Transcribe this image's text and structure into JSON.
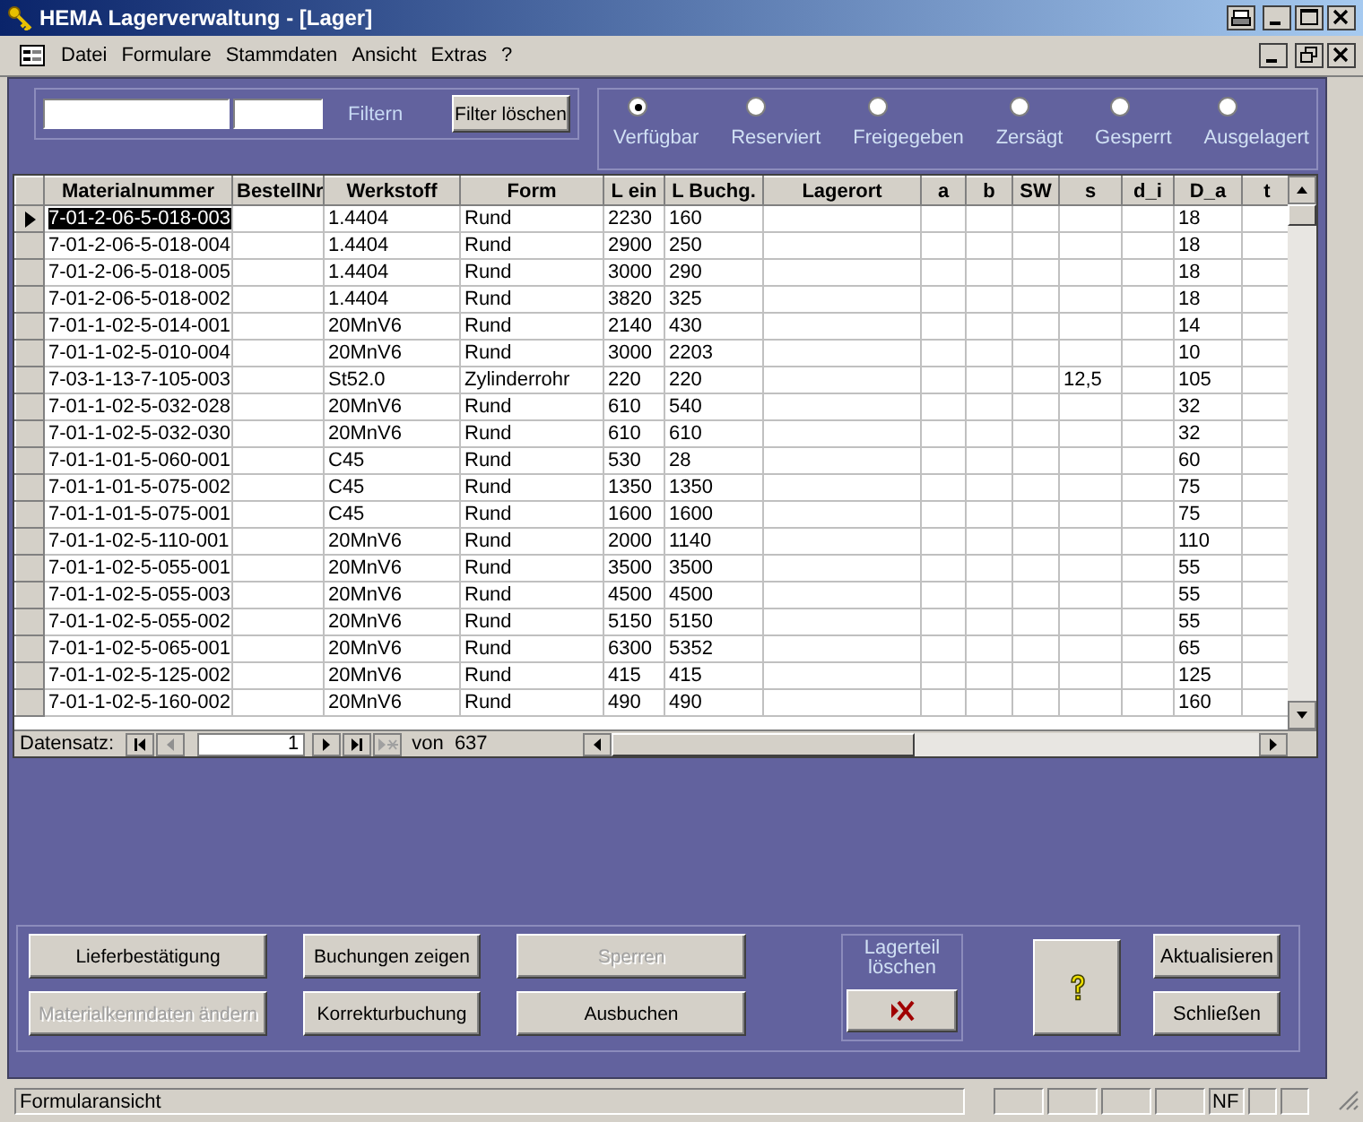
{
  "window": {
    "title": "HEMA Lagerverwaltung - [Lager]"
  },
  "menu": [
    {
      "label": "Datei"
    },
    {
      "label": "Formulare"
    },
    {
      "label": "Stammdaten"
    },
    {
      "label": "Ansicht"
    },
    {
      "label": "Extras"
    },
    {
      "label": "?"
    }
  ],
  "filter": {
    "label": "Filtern",
    "clear_button": "Filter löschen"
  },
  "status_options": [
    {
      "label": "Verfügbar",
      "selected": true
    },
    {
      "label": "Reserviert",
      "selected": false
    },
    {
      "label": "Freigegeben",
      "selected": false
    },
    {
      "label": "Zersägt",
      "selected": false
    },
    {
      "label": "Gesperrt",
      "selected": false
    },
    {
      "label": "Ausgelagert",
      "selected": false
    }
  ],
  "table": {
    "columns": [
      "Materialnummer",
      "BestellNr",
      "Werkstoff",
      "Form",
      "L ein",
      "L Buchg.",
      "Lagerort",
      "a",
      "b",
      "SW",
      "s",
      "d_i",
      "D_a",
      "t"
    ],
    "rows": [
      {
        "selected": true,
        "cells": [
          "7-01-2-06-5-018-003",
          null,
          "1.4404",
          "Rund",
          "2230",
          "160",
          null,
          null,
          null,
          null,
          null,
          null,
          "18",
          null
        ]
      },
      {
        "selected": false,
        "cells": [
          "7-01-2-06-5-018-004",
          null,
          "1.4404",
          "Rund",
          "2900",
          "250",
          null,
          null,
          null,
          null,
          null,
          null,
          "18",
          null
        ]
      },
      {
        "selected": false,
        "cells": [
          "7-01-2-06-5-018-005",
          null,
          "1.4404",
          "Rund",
          "3000",
          "290",
          null,
          null,
          null,
          null,
          null,
          null,
          "18",
          null
        ]
      },
      {
        "selected": false,
        "cells": [
          "7-01-2-06-5-018-002",
          null,
          "1.4404",
          "Rund",
          "3820",
          "325",
          null,
          null,
          null,
          null,
          null,
          null,
          "18",
          null
        ]
      },
      {
        "selected": false,
        "cells": [
          "7-01-1-02-5-014-001",
          null,
          "20MnV6",
          "Rund",
          "2140",
          "430",
          null,
          null,
          null,
          null,
          null,
          null,
          "14",
          null
        ]
      },
      {
        "selected": false,
        "cells": [
          "7-01-1-02-5-010-004",
          null,
          "20MnV6",
          "Rund",
          "3000",
          "2203",
          null,
          null,
          null,
          null,
          null,
          null,
          "10",
          null
        ]
      },
      {
        "selected": false,
        "cells": [
          "7-03-1-13-7-105-003",
          null,
          "St52.0",
          "Zylinderrohr",
          "220",
          "220",
          null,
          null,
          null,
          null,
          "12,5",
          null,
          "105",
          null
        ]
      },
      {
        "selected": false,
        "cells": [
          "7-01-1-02-5-032-028",
          null,
          "20MnV6",
          "Rund",
          "610",
          "540",
          null,
          null,
          null,
          null,
          null,
          null,
          "32",
          null
        ]
      },
      {
        "selected": false,
        "cells": [
          "7-01-1-02-5-032-030",
          null,
          "20MnV6",
          "Rund",
          "610",
          "610",
          null,
          null,
          null,
          null,
          null,
          null,
          "32",
          null
        ]
      },
      {
        "selected": false,
        "cells": [
          "7-01-1-01-5-060-001",
          null,
          "C45",
          "Rund",
          "530",
          "28",
          null,
          null,
          null,
          null,
          null,
          null,
          "60",
          null
        ]
      },
      {
        "selected": false,
        "cells": [
          "7-01-1-01-5-075-002",
          null,
          "C45",
          "Rund",
          "1350",
          "1350",
          null,
          null,
          null,
          null,
          null,
          null,
          "75",
          null
        ]
      },
      {
        "selected": false,
        "cells": [
          "7-01-1-01-5-075-001",
          null,
          "C45",
          "Rund",
          "1600",
          "1600",
          null,
          null,
          null,
          null,
          null,
          null,
          "75",
          null
        ]
      },
      {
        "selected": false,
        "cells": [
          "7-01-1-02-5-110-001",
          null,
          "20MnV6",
          "Rund",
          "2000",
          "1140",
          null,
          null,
          null,
          null,
          null,
          null,
          "110",
          null
        ]
      },
      {
        "selected": false,
        "cells": [
          "7-01-1-02-5-055-001",
          null,
          "20MnV6",
          "Rund",
          "3500",
          "3500",
          null,
          null,
          null,
          null,
          null,
          null,
          "55",
          null
        ]
      },
      {
        "selected": false,
        "cells": [
          "7-01-1-02-5-055-003",
          null,
          "20MnV6",
          "Rund",
          "4500",
          "4500",
          null,
          null,
          null,
          null,
          null,
          null,
          "55",
          null
        ]
      },
      {
        "selected": false,
        "cells": [
          "7-01-1-02-5-055-002",
          null,
          "20MnV6",
          "Rund",
          "5150",
          "5150",
          null,
          null,
          null,
          null,
          null,
          null,
          "55",
          null
        ]
      },
      {
        "selected": false,
        "cells": [
          "7-01-1-02-5-065-001",
          null,
          "20MnV6",
          "Rund",
          "6300",
          "5352",
          null,
          null,
          null,
          null,
          null,
          null,
          "65",
          null
        ]
      },
      {
        "selected": false,
        "cells": [
          "7-01-1-02-5-125-002",
          null,
          "20MnV6",
          "Rund",
          "415",
          "415",
          null,
          null,
          null,
          null,
          null,
          null,
          "125",
          null
        ]
      },
      {
        "selected": false,
        "cells": [
          "7-01-1-02-5-160-002",
          null,
          "20MnV6",
          "Rund",
          "490",
          "490",
          null,
          null,
          null,
          null,
          null,
          null,
          "160",
          null
        ]
      }
    ]
  },
  "navigation": {
    "label": "Datensatz:",
    "record": "1",
    "total": "von  637"
  },
  "action_buttons": [
    {
      "label": "Lieferbestätigung",
      "disabled": false
    },
    {
      "label": "Buchungen zeigen",
      "disabled": false
    },
    {
      "label": "Sperren",
      "disabled": true
    },
    {
      "label": "Materialkenndaten ändern",
      "disabled": true
    },
    {
      "label": "Korrekturbuchung",
      "disabled": false
    },
    {
      "label": "Ausbuchen",
      "disabled": false
    }
  ],
  "delete_group": {
    "label": "Lagerteil löschen"
  },
  "side_buttons": [
    {
      "label": "Aktualisieren"
    },
    {
      "label": "Schließen"
    }
  ],
  "status_bar": {
    "text": "Formularansicht",
    "indicator": "NF"
  }
}
